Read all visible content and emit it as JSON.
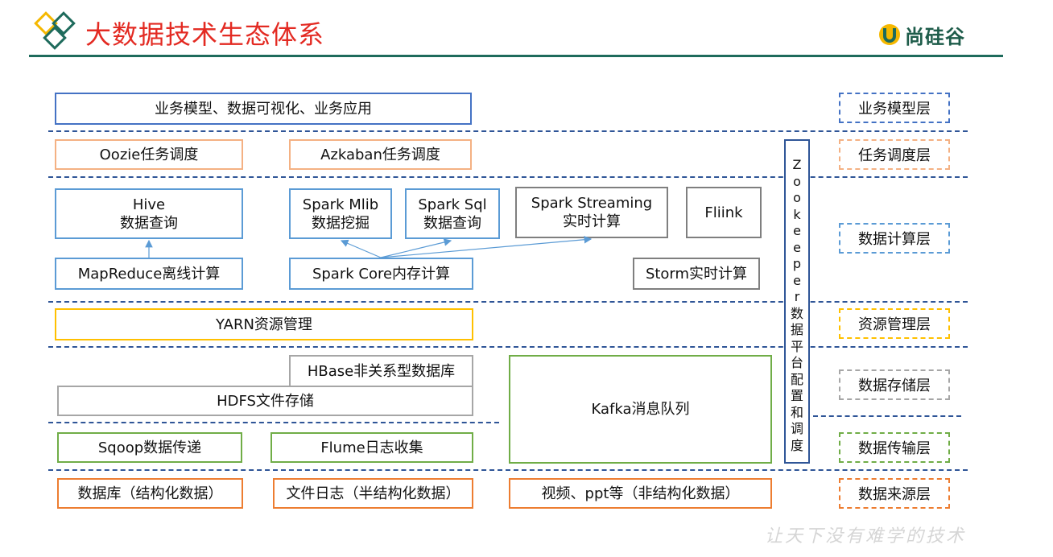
{
  "header": {
    "title": "大数据技术生态体系",
    "logo_text": "尚硅谷"
  },
  "boxes": {
    "business_app": "业务模型、数据可视化、业务应用",
    "oozie": "Oozie任务调度",
    "azkaban": "Azkaban任务调度",
    "hive_line1": "Hive",
    "hive_line2": "数据查询",
    "mllib_line1": "Spark Mlib",
    "mllib_line2": "数据挖掘",
    "sparksql_line1": "Spark Sql",
    "sparksql_line2": "数据查询",
    "streaming_line1": "Spark Streaming",
    "streaming_line2": "实时计算",
    "flink": "Fliink",
    "mapreduce": "MapReduce离线计算",
    "sparkcore": "Spark Core内存计算",
    "storm": "Storm实时计算",
    "yarn": "YARN资源管理",
    "hbase": "HBase非关系型数据库",
    "hdfs": "HDFS文件存储",
    "kafka": "Kafka消息队列",
    "sqoop": "Sqoop数据传递",
    "flume": "Flume日志收集",
    "src_db": "数据库（结构化数据）",
    "src_log": "文件日志（半结构化数据）",
    "src_video": "视频、ppt等（非结构化数据）"
  },
  "zookeeper": {
    "chars": [
      "Z",
      "o",
      "o",
      "k",
      "e",
      "e",
      "p",
      "e",
      "r",
      "数",
      "据",
      "平",
      "台",
      "配",
      "置",
      "和",
      "调",
      "度"
    ]
  },
  "layers": {
    "business": "业务模型层",
    "scheduling": "任务调度层",
    "compute": "数据计算层",
    "resource": "资源管理层",
    "storage": "数据存储层",
    "transport": "数据传输层",
    "source": "数据来源层"
  },
  "colors": {
    "title_red": "#e32a22",
    "brand_green": "#1e6b5c",
    "separator_blue": "#2f5597",
    "logo_yellow": "#f5b800"
  },
  "footer": {
    "slogan": "让天下没有难学的技术"
  }
}
